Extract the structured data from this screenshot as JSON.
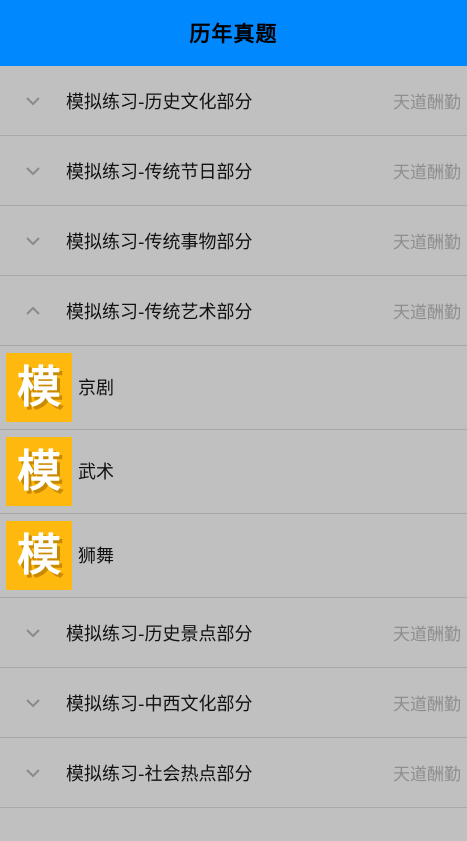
{
  "header": {
    "title": "历年真题"
  },
  "groups_top": [
    {
      "title": "模拟练习-历史文化部分",
      "meta": "天道酬勤",
      "expanded": false
    },
    {
      "title": "模拟练习-传统节日部分",
      "meta": "天道酬勤",
      "expanded": false
    },
    {
      "title": "模拟练习-传统事物部分",
      "meta": "天道酬勤",
      "expanded": false
    },
    {
      "title": "模拟练习-传统艺术部分",
      "meta": "天道酬勤",
      "expanded": true
    }
  ],
  "children": [
    {
      "glyph": "模",
      "label": "京剧"
    },
    {
      "glyph": "模",
      "label": "武术"
    },
    {
      "glyph": "模",
      "label": "狮舞"
    }
  ],
  "groups_bottom": [
    {
      "title": "模拟练习-历史景点部分",
      "meta": "天道酬勤",
      "expanded": false
    },
    {
      "title": "模拟练习-中西文化部分",
      "meta": "天道酬勤",
      "expanded": false
    },
    {
      "title": "模拟练习-社会热点部分",
      "meta": "天道酬勤",
      "expanded": false
    }
  ],
  "colors": {
    "header_bg": "#0088ff",
    "list_bg": "#c0c0c0",
    "thumb_bg": "#ffb80e",
    "meta_text": "#8e8e8e"
  },
  "icons": {
    "collapsed": "chevron-down-icon",
    "expanded": "chevron-up-icon"
  }
}
